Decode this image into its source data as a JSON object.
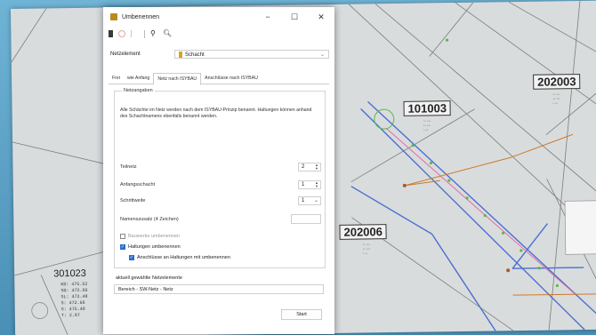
{
  "dialog": {
    "title": "Umbenennen",
    "window_buttons": {
      "minimize": "−",
      "maximize": "☐",
      "close": "✕"
    },
    "netzelement_label": "Netzelement",
    "netzelement_value": "Schacht",
    "tabs": [
      {
        "label": "Frei"
      },
      {
        "label": "wie Anfang"
      },
      {
        "label": "Netz nach ISYBAU"
      },
      {
        "label": "Anschlüsse nach ISYBAU"
      }
    ],
    "group_title": "Netzangaben",
    "description": "Alle Schächte im Netz werden nach dem ISYBAU-Prinzip benannt. Haltungen können anhand des Schachtnamens ebenfalls benannt werden.",
    "fields": [
      {
        "label": "Teilnetz",
        "value": "2"
      },
      {
        "label": "Anfangsschacht",
        "value": "1"
      },
      {
        "label": "Schrittweite",
        "value": "1"
      },
      {
        "label": "Namenszusatz (4 Zeichen)",
        "value": ""
      }
    ],
    "checkboxes": [
      {
        "label": "Bauwerke umbenennen",
        "checked": false,
        "enabled": false
      },
      {
        "label": "Haltungen umbenennen",
        "checked": true,
        "enabled": true
      },
      {
        "label": "Anschlüsse an Haltungen mit umbenennen",
        "checked": true,
        "enabled": true
      }
    ],
    "selected_label": "aktuell gewählte Netzelemente",
    "selected_value": "Bereich - SW-Netz - Netz",
    "start_button": "Start"
  },
  "map": {
    "labels": [
      {
        "text": "101003"
      },
      {
        "text": "202003"
      },
      {
        "text": "202006"
      },
      {
        "text": "301023"
      }
    ],
    "info_301023": [
      "KD: 475.52",
      "SO: 472.66",
      "SL: 472.48",
      "S: 472.66",
      "S: 475.48",
      "T: 2.87"
    ]
  }
}
